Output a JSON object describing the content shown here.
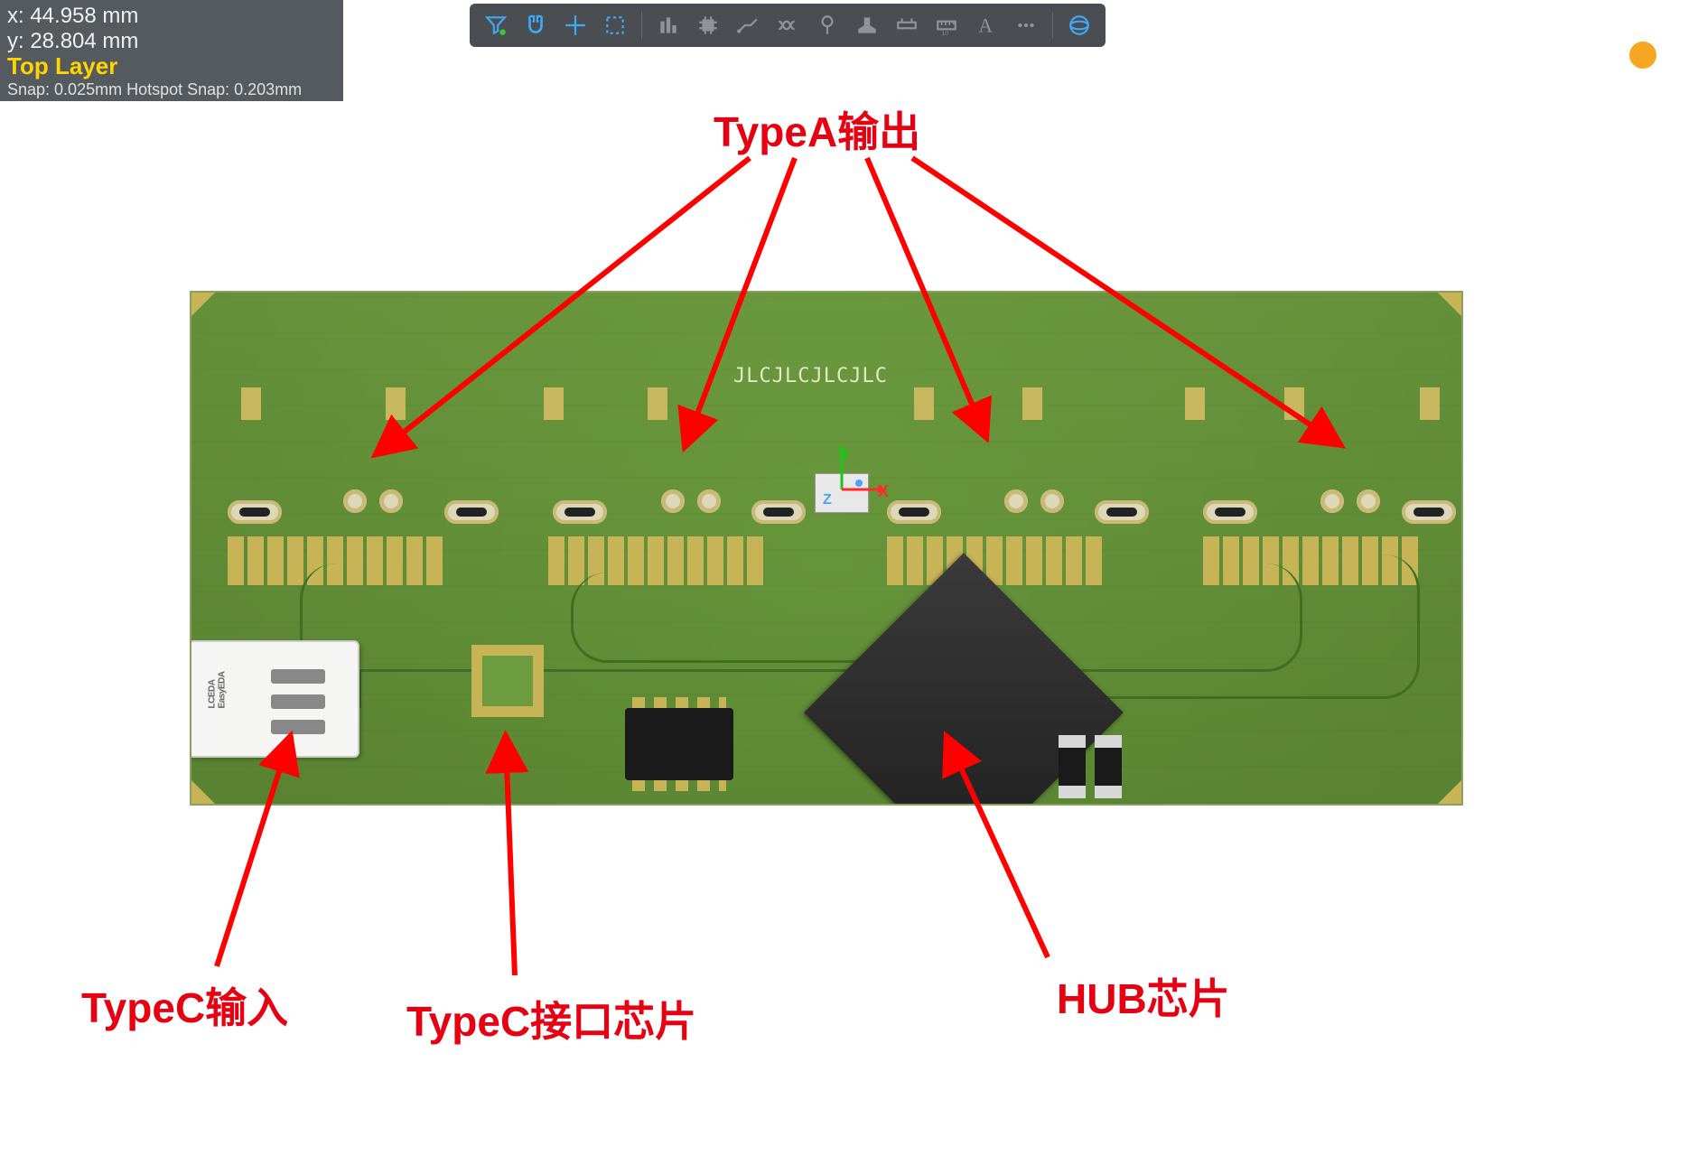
{
  "status": {
    "x_label": "x: 44.958 mm",
    "y_label": "y: 28.804 mm",
    "layer": "Top Layer",
    "snap": "Snap: 0.025mm Hotspot Snap: 0.203mm"
  },
  "toolbar": {
    "tools": [
      {
        "name": "filter",
        "title": "Filter",
        "active": true
      },
      {
        "name": "snap",
        "title": "Snap / Magnet",
        "active": true
      },
      {
        "name": "crosshair",
        "title": "Crosshair",
        "active": true
      },
      {
        "name": "marquee",
        "title": "Rect Select",
        "active": true
      },
      {
        "name": "align",
        "title": "Align/Distribute",
        "active": false
      },
      {
        "name": "chip",
        "title": "Place Component",
        "active": false
      },
      {
        "name": "route",
        "title": "Route Track",
        "active": false
      },
      {
        "name": "diffpair",
        "title": "Diff Pair",
        "active": false
      },
      {
        "name": "via",
        "title": "Place Via",
        "active": false
      },
      {
        "name": "plane",
        "title": "Copper Region",
        "active": false
      },
      {
        "name": "measure",
        "title": "Dimension",
        "active": false
      },
      {
        "name": "ruler",
        "title": "Ruler",
        "active": false
      },
      {
        "name": "text",
        "title": "Place Text",
        "active": false
      },
      {
        "name": "more",
        "title": "More",
        "active": false
      },
      {
        "name": "view3d",
        "title": "3D View",
        "active": true
      }
    ]
  },
  "origin_axes": {
    "x": "X",
    "y": "Y",
    "z": "Z"
  },
  "pcb": {
    "silk_text": "JLCJLCJLCJLC",
    "usbc_logo_line1": "LCEDA",
    "usbc_logo_line2": "EasyEDA"
  },
  "annotations": {
    "typea_output": "TypeA输出",
    "typec_input": "TypeC输入",
    "typec_iface_chip": "TypeC接口芯片",
    "hub_chip": "HUB芯片"
  },
  "colors": {
    "annotation": "#e60012",
    "layer_text": "#ffd400",
    "pcb_green": "#6d9c3f",
    "copper": "#c7b456"
  }
}
